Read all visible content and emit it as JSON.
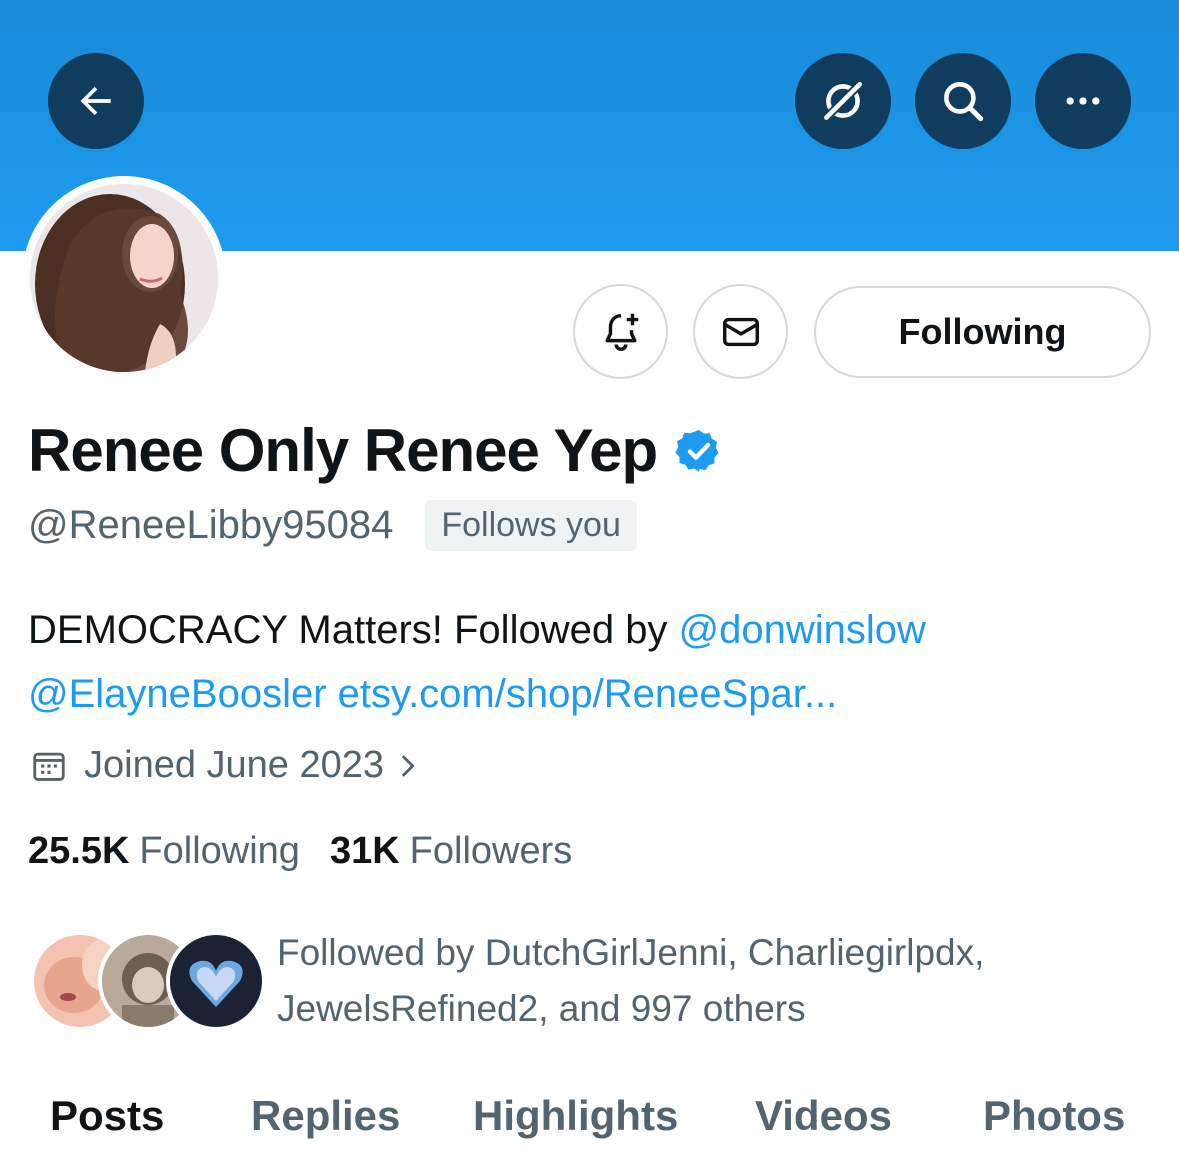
{
  "header": {
    "back_icon": "arrow-left-icon",
    "actions": [
      {
        "name": "grok-icon"
      },
      {
        "name": "search-icon"
      },
      {
        "name": "more-icon"
      }
    ]
  },
  "profile": {
    "display_name": "Renee Only Renee Yep",
    "verified": true,
    "handle": "@ReneeLibby95084",
    "follows_you": "Follows you",
    "bio": {
      "text": "DEMOCRACY Matters! Followed by ",
      "mention1": "@donwinslow",
      "mention2": "@ElayneBoosler",
      "link": "etsy.com/shop/ReneeSpar..."
    },
    "joined": "Joined June 2023",
    "following_count": "25.5K",
    "following_label": "Following",
    "followers_count": "31K",
    "followers_label": "Followers",
    "followed_by": "Followed by DutchGirlJenni, Charliegirlpdx, JewelsRefined2, and 997 others"
  },
  "buttons": {
    "following": "Following"
  },
  "tabs": [
    "Posts",
    "Replies",
    "Highlights",
    "Videos",
    "Photos"
  ],
  "colors": {
    "accent": "#1d9bf0",
    "header_button": "#103d5e",
    "secondary_text": "#536471"
  }
}
